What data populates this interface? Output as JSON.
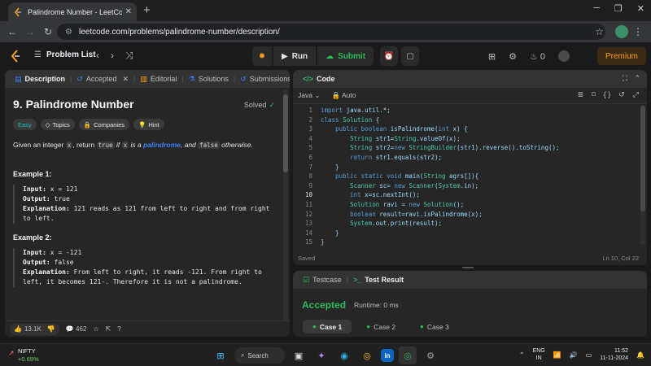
{
  "browser": {
    "tab_title": "Palindrome Number - LeetCode",
    "url": "leetcode.com/problems/palindrome-number/description/"
  },
  "nav": {
    "problem_list": "Problem List",
    "run_label": "Run",
    "submit_label": "Submit",
    "streak_count": "0",
    "premium_label": "Premium"
  },
  "left_tabs": [
    {
      "label": "Description"
    },
    {
      "label": "Accepted"
    },
    {
      "label": "Editorial"
    },
    {
      "label": "Solutions"
    },
    {
      "label": "Submissions"
    }
  ],
  "problem": {
    "title": "9. Palindrome Number",
    "solved_label": "Solved",
    "tags": [
      "Easy",
      "Topics",
      "Companies",
      "Hint"
    ],
    "statement": {
      "p1": "Given an integer ",
      "x1": "x",
      "p2": ", return ",
      "t1": "true",
      "p3": " if ",
      "x2": "x",
      "p4": " is a ",
      "link": "palindrome",
      "p5": ", and ",
      "f1": "false",
      "p6": " otherwise."
    },
    "examples": [
      {
        "heading": "Example 1:",
        "input_label": "Input:",
        "input": " x = 121",
        "output_label": "Output:",
        "output": " true",
        "expl_label": "Explanation:",
        "explanation": " 121 reads as 121 from left to right and from right to left."
      },
      {
        "heading": "Example 2:",
        "input_label": "Input:",
        "input": " x = -121",
        "output_label": "Output:",
        "output": " false",
        "expl_label": "Explanation:",
        "explanation": " From left to right, it reads -121. From right to left, it becomes 121-. Therefore it is not a palindrome."
      }
    ],
    "likes": "13.1K",
    "comments": "462"
  },
  "code": {
    "header": "Code",
    "language": "Java",
    "mode": "Auto",
    "status_left": "Saved",
    "status_right": "Ln 10, Col 22",
    "lines": [
      "import java.util.*;",
      "class Solution {",
      "    public boolean isPalindrome(int x) {",
      "        String str1=String.valueOf(x);",
      "        String str2=new StringBuilder(str1).reverse().toString();",
      "        return str1.equals(str2);",
      "    }",
      "    public static void main(String agrs[]){",
      "        Scanner sc= new Scanner(System.in);",
      "        int x=sc.nextInt();",
      "        Solution ravi = new Solution();",
      "        boolean result=ravi.isPalindrome(x);",
      "        System.out.print(result);",
      "    }",
      "}"
    ],
    "current_line": 10
  },
  "result": {
    "tab_testcase": "Testcase",
    "tab_result": "Test Result",
    "status": "Accepted",
    "runtime": "Runtime: 0 ms",
    "cases": [
      "Case 1",
      "Case 2",
      "Case 3"
    ]
  },
  "taskbar": {
    "ticker_name": "NIFTY",
    "ticker_change": "+0.69%",
    "search_label": "Search",
    "lang_top": "ENG",
    "lang_bottom": "IN",
    "time": "11:52",
    "date": "11-11-2024"
  },
  "colors": {
    "accent_orange": "#ffa116",
    "accent_green": "#2cbb5d",
    "easy_teal": "#1cbaba",
    "link_blue": "#3b82f6"
  }
}
